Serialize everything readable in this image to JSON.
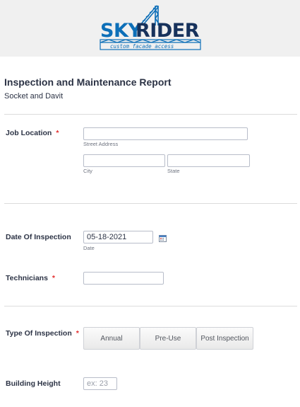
{
  "brand": {
    "logo_text_a": "SKY",
    "logo_text_b": "RIDER",
    "tagline": "custom facade access",
    "colors": {
      "primary": "#0d6fb8",
      "dark": "#17325c",
      "header_bg": "#f0f0f0"
    }
  },
  "form": {
    "title": "Inspection and Maintenance Report",
    "subtitle": "Socket and Davit",
    "required_mark": "*"
  },
  "job_location": {
    "label": "Job Location",
    "street_value": "",
    "street_sublabel": "Street Address",
    "city_value": "",
    "city_sublabel": "City",
    "state_value": "",
    "state_sublabel": "State"
  },
  "date_of_inspection": {
    "label": "Date Of Inspection",
    "value": "05-18-2021",
    "sublabel": "Date",
    "icon": "calendar-icon"
  },
  "technicians": {
    "label": "Technicians",
    "value": ""
  },
  "type_of_inspection": {
    "label": "Type Of Inspection",
    "options": [
      "Annual",
      "Pre-Use",
      "Post Inspection"
    ]
  },
  "building_height": {
    "label": "Building Height",
    "placeholder": "ex: 23"
  }
}
